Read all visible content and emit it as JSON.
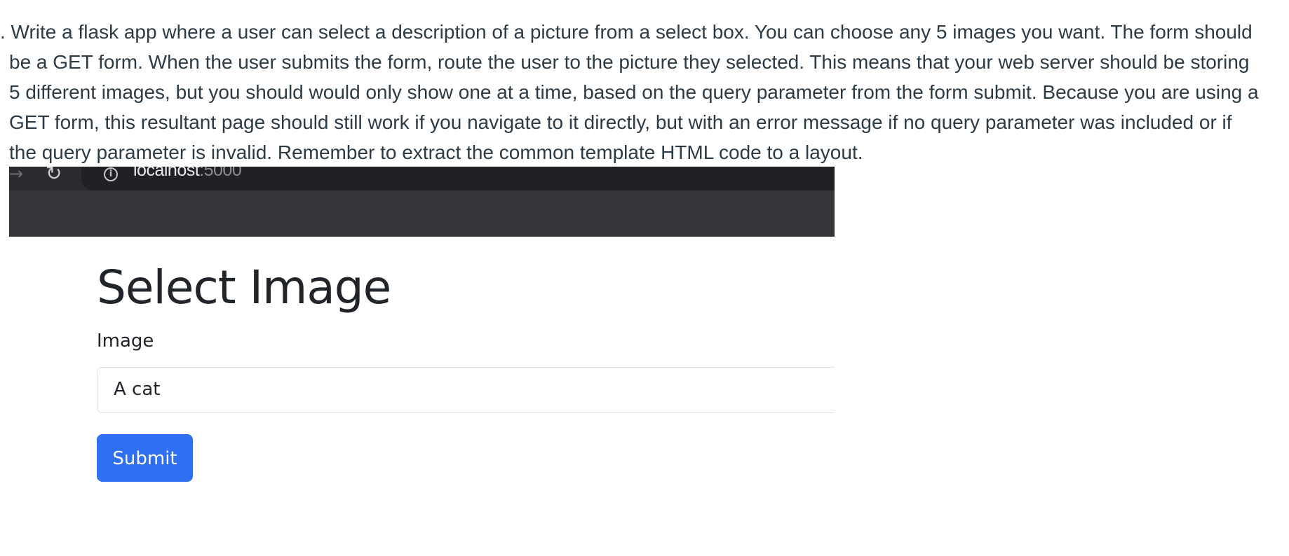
{
  "instructions": {
    "lines": [
      ". Write a flask app where a user can select a description of a picture from a select box. You can choose any 5 images you want. The form should",
      "be a GET form. When the user submits the form, route the user to the picture they selected. This means that your web server should be storing",
      "5 different images, but you should would only show one at a time, based on the query parameter from the form submit. Because you are using a",
      "GET form, this resultant page should still work if you navigate to it directly, but with an error message if no query parameter was included or if",
      "the query parameter is invalid. Remember to extract the common template HTML code to a layout."
    ]
  },
  "browser": {
    "url_host": "localhost",
    "url_port": ":5000",
    "icons": {
      "forward": "forward-arrow-icon",
      "reload": "reload-icon",
      "info": "info-icon"
    },
    "colors": {
      "toolbar": "#35363a",
      "address_bar": "#202124"
    }
  },
  "page": {
    "title": "Select Image",
    "field_label": "Image",
    "select_value": "A cat",
    "submit_label": "Submit",
    "colors": {
      "primary": "#2f6ff2",
      "text": "#212529"
    }
  }
}
